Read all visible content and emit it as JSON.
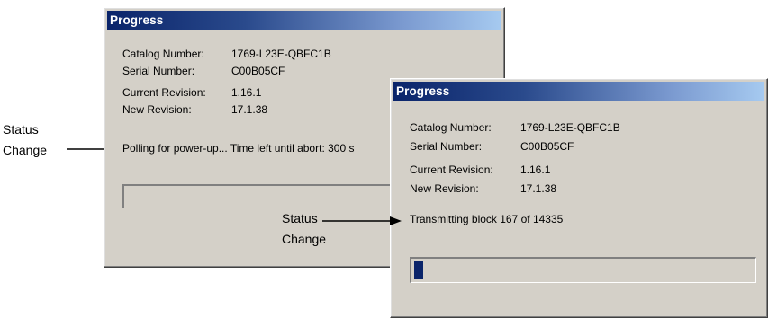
{
  "dialog_back": {
    "title": "Progress",
    "catalog_label": "Catalog Number:",
    "catalog_value": "1769-L23E-QBFC1B",
    "serial_label": "Serial Number:",
    "serial_value": "C00B05CF",
    "current_rev_label": "Current Revision:",
    "current_rev_value": "1.16.1",
    "new_rev_label": "New Revision:",
    "new_rev_value": "17.1.38",
    "status_text": "Polling for power-up... Time left until abort: 300 s",
    "progress_fraction": 0
  },
  "dialog_front": {
    "title": "Progress",
    "catalog_label": "Catalog Number:",
    "catalog_value": "1769-L23E-QBFC1B",
    "serial_label": "Serial Number:",
    "serial_value": "C00B05CF",
    "current_rev_label": "Current Revision:",
    "current_rev_value": "1.16.1",
    "new_rev_label": "New Revision:",
    "new_rev_value": "17.1.38",
    "status_text": "Transmitting block 167 of 14335",
    "progress_fraction": 0.012
  },
  "annotations": {
    "left_line1": "Status",
    "left_line2": "Change",
    "middle_line1": "Status",
    "middle_line2": "Change"
  }
}
